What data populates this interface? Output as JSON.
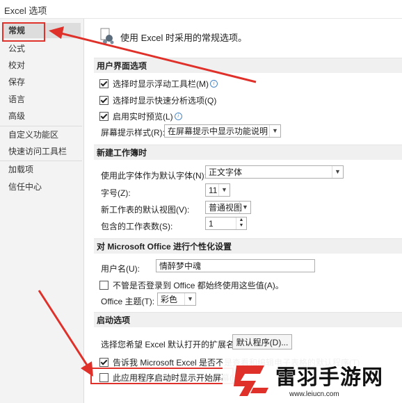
{
  "window": {
    "title": "Excel 选项"
  },
  "sidebar": {
    "items": [
      {
        "label": "常规",
        "active": true
      },
      {
        "label": "公式"
      },
      {
        "label": "校对"
      },
      {
        "label": "保存"
      },
      {
        "label": "语言"
      },
      {
        "label": "高级"
      },
      {
        "label": "自定义功能区"
      },
      {
        "label": "快速访问工具栏"
      },
      {
        "label": "加载项"
      },
      {
        "label": "信任中心"
      }
    ]
  },
  "header": {
    "text": "使用 Excel 时采用的常规选项。"
  },
  "ui_section": {
    "title": "用户界面选项",
    "opt_floating_toolbar": {
      "label": "选择时显示浮动工具栏(M)",
      "checked": true
    },
    "opt_quick_analysis": {
      "label": "选择时显示快速分析选项(Q)",
      "checked": true
    },
    "opt_live_preview": {
      "label": "启用实时预览(L)",
      "checked": true
    },
    "screentip_label": "屏幕提示样式(R):",
    "screentip_value": "在屏幕提示中显示功能说明"
  },
  "workbook_section": {
    "title": "新建工作簿时",
    "font_label": "使用此字体作为默认字体(N):",
    "font_value": "正文字体",
    "size_label": "字号(Z):",
    "size_value": "11",
    "view_label": "新工作表的默认视图(V):",
    "view_value": "普通视图",
    "sheets_label": "包含的工作表数(S):",
    "sheets_value": "1"
  },
  "personalize_section": {
    "title": "对 Microsoft Office 进行个性化设置",
    "username_label": "用户名(U):",
    "username_value": "情醉梦中魂",
    "always_use_label": "不管是否登录到 Office 都始终使用这些值(A)。",
    "always_use_checked": false,
    "theme_label": "Office 主题(T):",
    "theme_value": "彩色"
  },
  "startup_section": {
    "title": "启动选项",
    "extensions_label": "选择您希望 Excel 默认打开的扩展名:",
    "default_programs_button": "默认程序(D)...",
    "tell_me_label": "告诉我 Microsoft Excel 是否不是查看和编辑电子表格的默认程序(T)",
    "tell_me_checked": true,
    "start_screen_label": "此应用程序启动时显示开始屏幕(H)",
    "start_screen_checked": false
  },
  "watermark": {
    "title": "雷羽手游网",
    "url": "www.leiucn.com"
  },
  "colors": {
    "annotation_red": "#e0302a",
    "sidebar_bg": "#f3f3f3",
    "section_bg": "#f0f0f0"
  },
  "icons": {
    "info": "info-icon",
    "dropdown": "chevron-down-icon",
    "options": "options-icon"
  }
}
